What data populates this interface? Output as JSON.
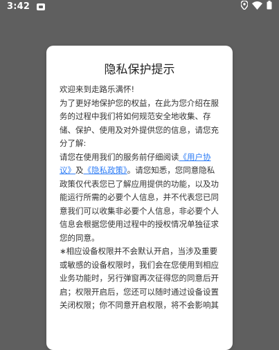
{
  "status_bar": {
    "time": "3:42",
    "icons": [
      "app-notification-icon",
      "location-icon",
      "wifi-icon",
      "battery-icon"
    ]
  },
  "dialog": {
    "title": "隐私保护提示",
    "para1": "欢迎来到走路乐满怀!",
    "para2": "为了更好地保护您的权益，在此为您介绍在服务的过程中我们将如何规范安全地收集、存储、保护、使用及对外提供您的信息，请您充分了解:",
    "para3_pre": "请您在使用我们的服务前仔细阅读",
    "user_agreement": "《用户协议》",
    "and": "及",
    "privacy_policy": "《隐私政策》",
    "para3_post": "。请您知悉，您同意隐私政策仅代表您已了解应用提供的功能，以及功能运行所需的必要个人信息，并不代表您已同意我们可以收集非必要个人信息，非必要个人信息会根据您使用过程中的授权情况单独征求您的同意。",
    "para4": "∗相应设备权限并不会默认开启，当涉及重要或敏感的设备权限时，我们会在您使用到相应业务功能时，另行弹窗再次征得您的同意后开启；权限开启后，您还可以随时通过设备设置关闭权限；你不同意开启权限，将不会影响其"
  },
  "colors": {
    "backdrop": "#5f5f5f",
    "link": "#2d7cf6"
  }
}
